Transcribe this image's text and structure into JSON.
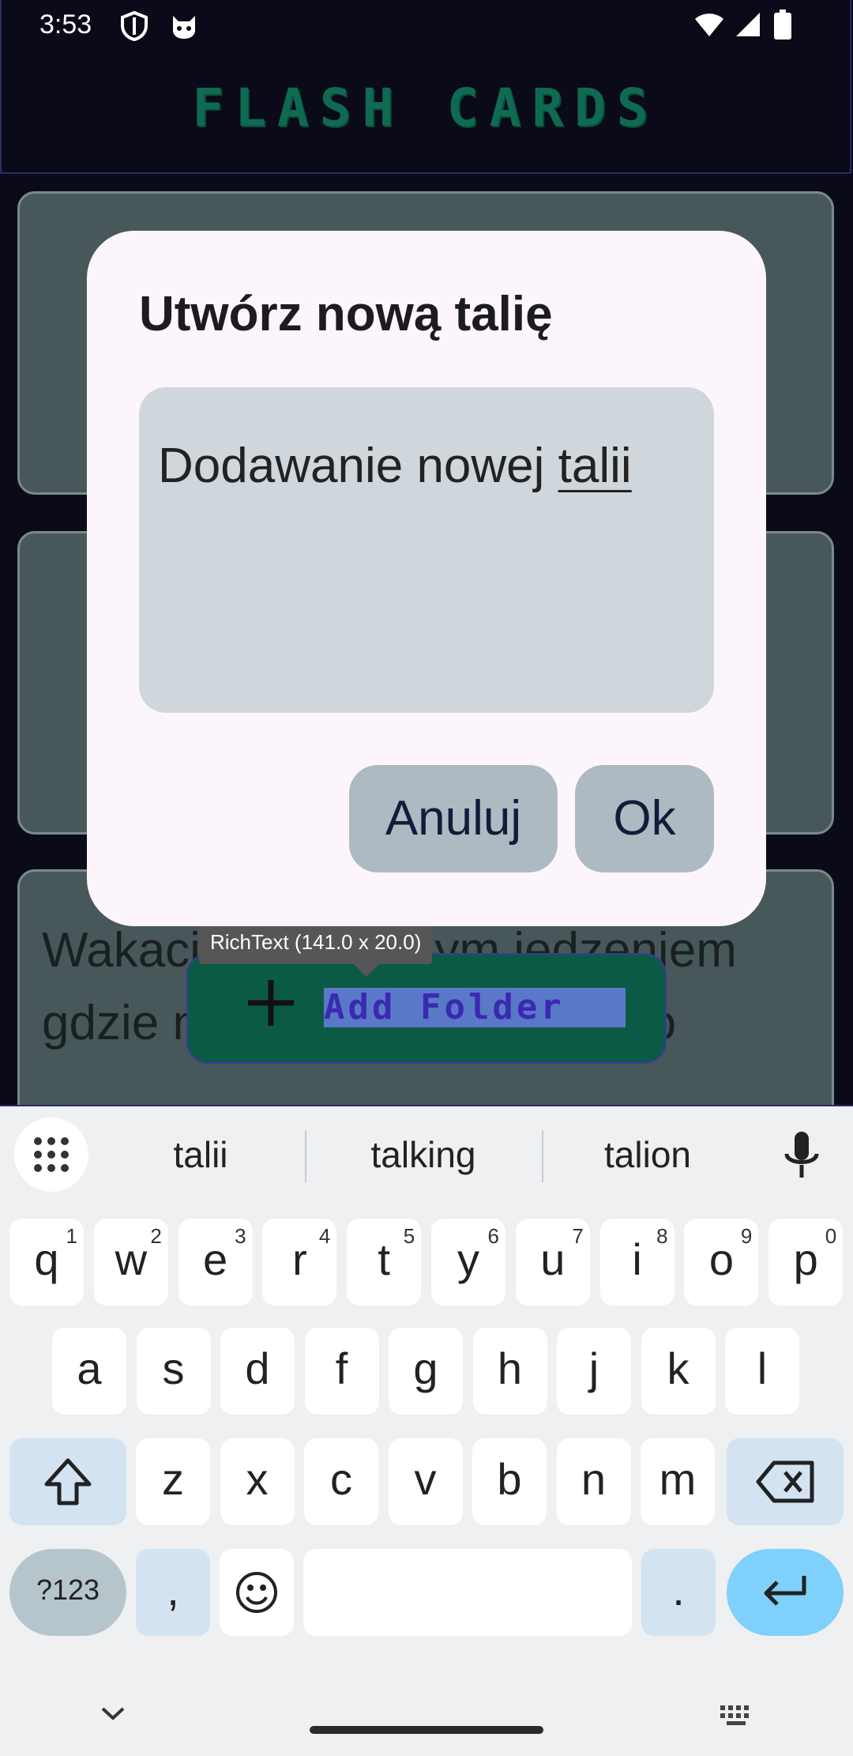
{
  "status_bar": {
    "time": "3:53",
    "icons": [
      "shield-icon",
      "cat-icon",
      "wifi-icon",
      "signal-icon",
      "battery-icon"
    ]
  },
  "app": {
    "title": "FLASH CARDS"
  },
  "cards": [
    {
      "text": ""
    },
    {
      "text": ""
    },
    {
      "text": "Wakacje, najlepszym jedzeniem gdzie nie było nic dobrego co"
    }
  ],
  "fab": {
    "label": "Add Folder",
    "icon": "plus-icon"
  },
  "tooltip": {
    "text": "RichText (141.0 x 20.0)"
  },
  "dialog": {
    "title": "Utwórz nową talię",
    "input_value_prefix": "Dodawanie nowej ",
    "input_value_composing": "talii",
    "cancel_label": "Anuluj",
    "ok_label": "Ok"
  },
  "keyboard": {
    "suggestions": [
      "talii",
      "talking",
      "talion"
    ],
    "row1": [
      {
        "k": "q",
        "h": "1"
      },
      {
        "k": "w",
        "h": "2"
      },
      {
        "k": "e",
        "h": "3"
      },
      {
        "k": "r",
        "h": "4"
      },
      {
        "k": "t",
        "h": "5"
      },
      {
        "k": "y",
        "h": "6"
      },
      {
        "k": "u",
        "h": "7"
      },
      {
        "k": "i",
        "h": "8"
      },
      {
        "k": "o",
        "h": "9"
      },
      {
        "k": "p",
        "h": "0"
      }
    ],
    "row2": [
      "a",
      "s",
      "d",
      "f",
      "g",
      "h",
      "j",
      "k",
      "l"
    ],
    "row3": [
      "z",
      "x",
      "c",
      "v",
      "b",
      "n",
      "m"
    ],
    "symbols_label": "?123",
    "comma_label": ",",
    "period_label": "."
  },
  "colors": {
    "accent_green": "#0f6a52",
    "dialog_bg": "#fdf5fc",
    "card_bg": "#48585a",
    "enter_key": "#7fd0fb"
  }
}
